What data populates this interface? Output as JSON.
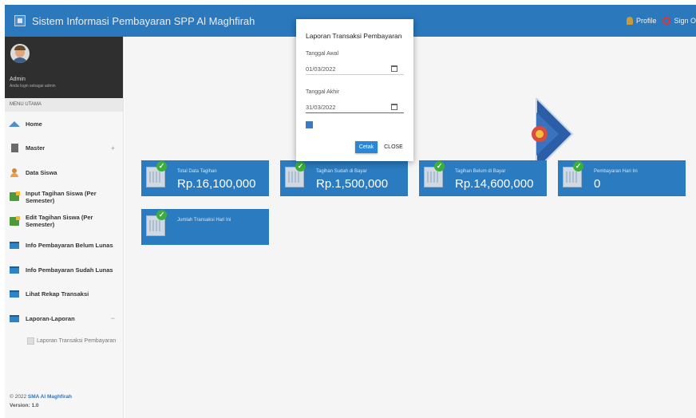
{
  "header": {
    "title": "Sistem Informasi Pembayaran SPP Al Maghfirah",
    "profile_label": "Profile",
    "signout_label": "Sign O"
  },
  "sidebar": {
    "user_name": "Admin",
    "user_sub": "Anda login sebagai admin",
    "menu_header": "MENU UTAMA",
    "items": [
      {
        "label": "Home",
        "icon": "home-icon"
      },
      {
        "label": "Master",
        "icon": "folder-icon",
        "toggle": "+"
      },
      {
        "label": "Data Siswa",
        "icon": "person-icon"
      },
      {
        "label": "Input Tagihan Siswa (Per Semester)",
        "icon": "edit-icon"
      },
      {
        "label": "Edit Tagihan Siswa (Per Semester)",
        "icon": "edit-icon"
      },
      {
        "label": "Info Pembayaran Belum Lunas",
        "icon": "document-icon"
      },
      {
        "label": "Info Pembayaran Sudah Lunas",
        "icon": "document-icon"
      },
      {
        "label": "Lihat Rekap Transaksi",
        "icon": "document-icon"
      },
      {
        "label": "Laporan-Laporan",
        "icon": "document-icon",
        "toggle": "−"
      }
    ],
    "submenu": [
      {
        "label": "Laporan Transaksi Pembayaran",
        "icon": "report-icon"
      }
    ],
    "footer_year": "© 2022",
    "footer_brand": "SMA Al Maghfirah",
    "footer_version_label": "Version:",
    "footer_version": "1.0"
  },
  "cards": [
    {
      "label": "Total Data Tagihan",
      "value": "Rp.16,100,000"
    },
    {
      "label": "Tagihan Sudah di Bayar",
      "value": "Rp.1,500,000"
    },
    {
      "label": "Tagihan Belum di Bayar",
      "value": "Rp.14,600,000"
    },
    {
      "label": "Pembayaran Hari Ini",
      "value": "0"
    },
    {
      "label": "Jumlah Transaksi Hari Ini",
      "value": ""
    }
  ],
  "modal": {
    "title": "Laporan Transaksi Pembayaran",
    "start_label": "Tanggal Awal",
    "start_value": "01/03/2022",
    "end_label": "Tanggal Akhir",
    "end_value": "31/03/2022",
    "print_button": "Cetak",
    "close_button": "CLOSE"
  },
  "colors": {
    "primary": "#2b78bd",
    "card": "#2a7bbf",
    "sidebar_dark": "#2f2f2f",
    "check": "#3cae3c",
    "signout": "#e8312f"
  }
}
